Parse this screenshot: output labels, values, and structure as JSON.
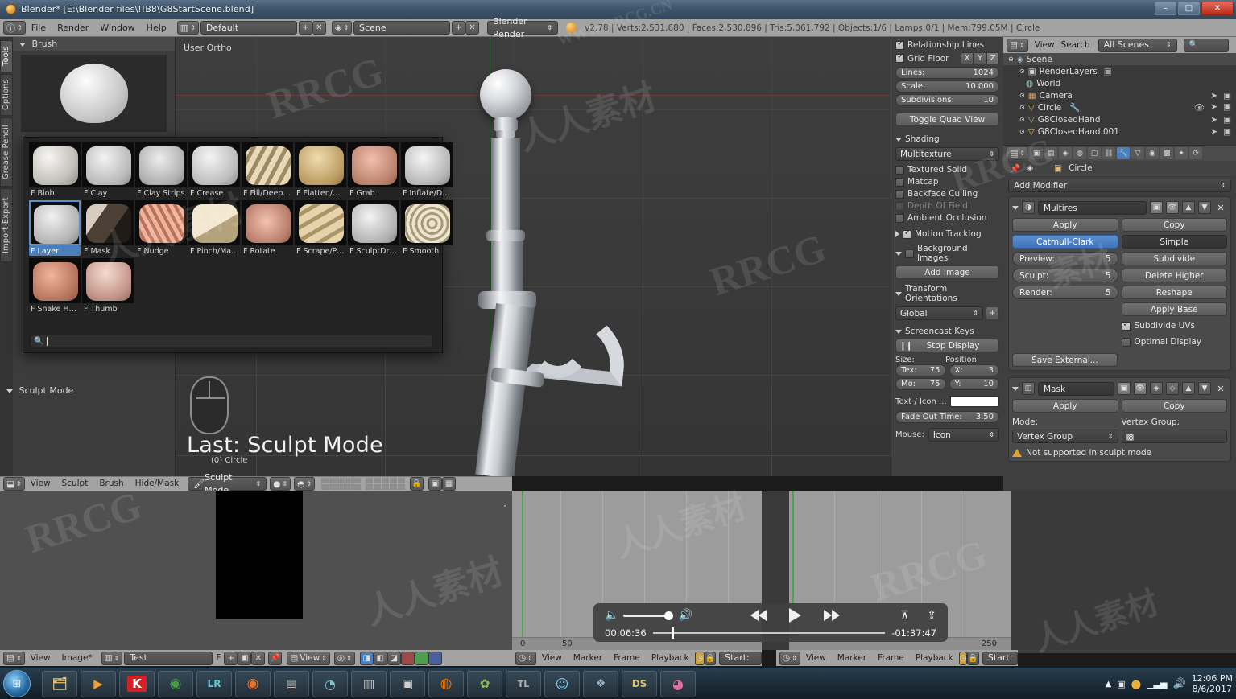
{
  "window": {
    "title": "Blender* [E:\\Blender files\\!!B8\\G8StartScene.blend]",
    "minimize": "–",
    "maximize": "□",
    "close": "✕"
  },
  "infobar": {
    "menus": [
      "File",
      "Render",
      "Window",
      "Help"
    ],
    "screen_layout": "Default",
    "scene_name": "Scene",
    "engine": "Blender Render",
    "stats": "v2.78 | Verts:2,531,680 | Faces:2,530,896 | Tris:5,061,792 | Objects:1/6 | Lamps:0/1 | Mem:799.05M | Circle",
    "add_icon": "+",
    "remove_icon": "✕"
  },
  "toolshelf": {
    "tabs": [
      "Tools",
      "Options",
      "Grease Pencil",
      "Import-Export"
    ],
    "active_tab": "Tools",
    "panel_title": "Brush",
    "sculpt_mode_panel": "Sculpt Mode"
  },
  "brush_popup": {
    "search_placeholder": "",
    "selected": "F Layer",
    "items": [
      {
        "label": "F Blob",
        "c1": "#f2f0ee",
        "c2": "#b9b4ae"
      },
      {
        "label": "F Clay",
        "c1": "#efefef",
        "c2": "#b3b3b3"
      },
      {
        "label": "F Clay Strips",
        "c1": "#e9e9e9",
        "c2": "#acacac"
      },
      {
        "label": "F Crease",
        "c1": "#f3f3f3",
        "c2": "#b6b6b6"
      },
      {
        "label": "F Fill/Deepen",
        "c1": "#e8d9b8",
        "c2": "#9d8a64"
      },
      {
        "label": "F Flatten/Co...",
        "c1": "#e4cd9f",
        "c2": "#b99a63"
      },
      {
        "label": "F Grab",
        "c1": "#e8b6a6",
        "c2": "#b97f6a"
      },
      {
        "label": "F Inflate/Defl",
        "c1": "#f1f1f1",
        "c2": "#b0b0b0"
      },
      {
        "label": "F Layer",
        "c1": "#ededed",
        "c2": "#adadad"
      },
      {
        "label": "F Mask",
        "c1": "#6b5a4e",
        "c2": "#2e2723"
      },
      {
        "label": "F Nudge",
        "c1": "#e9a892",
        "c2": "#b06e57"
      },
      {
        "label": "F Pinch/Mag...",
        "c1": "#efe2c6",
        "c2": "#b6a versus"
      },
      {
        "label": "F Rotate",
        "c1": "#efb9a4",
        "c2": "#b8776a"
      },
      {
        "label": "F Scrape/Pea",
        "c1": "#e3d0a8",
        "c2": "#aa9466"
      },
      {
        "label": "F SculptDraw",
        "c1": "#f0f0f0",
        "c2": "#aeaeae"
      },
      {
        "label": "F Smooth",
        "c1": "#e6ddc6",
        "c2": "#a59a7c"
      },
      {
        "label": "F Snake Hook",
        "c1": "#eaa892",
        "c2": "#b3705a"
      },
      {
        "label": "F Thumb",
        "c1": "#f0cfc4",
        "c2": "#bb8b7e"
      }
    ]
  },
  "viewport": {
    "view_label": "User Ortho",
    "last_operator": "Last: Sculpt Mode",
    "last_operator_sub": "(0) Circle"
  },
  "npanel": {
    "relationship_lines": "Relationship Lines",
    "grid_floor": "Grid Floor",
    "axes": [
      "X",
      "Y",
      "Z"
    ],
    "lines_label": "Lines:",
    "lines_value": "1024",
    "scale_label": "Scale:",
    "scale_value": "10.000",
    "subdiv_label": "Subdivisions:",
    "subdiv_value": "10",
    "toggle_quad_view": "Toggle Quad View",
    "shading_title": "Shading",
    "shading_mode": "Multitexture",
    "shading_options": [
      "Textured Solid",
      "Matcap",
      "Backface Culling",
      "Depth Of Field",
      "Ambient Occlusion"
    ],
    "motion_tracking": "Motion Tracking",
    "background_images": "Background Images",
    "add_image": "Add Image",
    "transform_orientations": "Transform Orientations",
    "orientation": "Global",
    "screencast_title": "Screencast Keys",
    "stop_display": "Stop Display",
    "size_label": "Size:",
    "position_label": "Position:",
    "tex_label": "Tex:",
    "tex_value": "75",
    "mo_label": "Mo:",
    "mo_value": "75",
    "x_label": "X:",
    "x_value": "3",
    "y_label": "Y:",
    "y_value": "10",
    "text_icon_label": "Text / Icon ...",
    "text_icon_value": "",
    "fade_label": "Fade Out Time:",
    "fade_value": "3.50",
    "mouse_label": "Mouse:",
    "mouse_value": "Icon"
  },
  "outliner": {
    "menus": [
      "View",
      "Search"
    ],
    "scope": "All Scenes",
    "search_value": "",
    "rows": [
      {
        "label": "Scene",
        "indent": 0,
        "selected": true
      },
      {
        "label": "RenderLayers",
        "indent": 1,
        "selected": false
      },
      {
        "label": "World",
        "indent": 1,
        "selected": false
      },
      {
        "label": "Camera",
        "indent": 1,
        "selected": false
      },
      {
        "label": "Circle",
        "indent": 1,
        "selected": false
      },
      {
        "label": "G8ClosedHand",
        "indent": 1,
        "selected": false
      },
      {
        "label": "G8ClosedHand.001",
        "indent": 1,
        "selected": false
      }
    ]
  },
  "properties": {
    "breadcrumb_object": "Circle",
    "add_modifier": "Add Modifier",
    "modifiers": [
      {
        "name": "Multires",
        "apply": "Apply",
        "copy": "Copy",
        "subdiv_type_a": "Catmull-Clark",
        "subdiv_type_b": "Simple",
        "levels": [
          {
            "label": "Preview:",
            "value": "5"
          },
          {
            "label": "Sculpt:",
            "value": "5"
          },
          {
            "label": "Render:",
            "value": "5"
          }
        ],
        "actions": [
          "Subdivide",
          "Delete Higher",
          "Reshape",
          "Apply Base"
        ],
        "checks": [
          {
            "label": "Subdivide UVs",
            "on": true
          },
          {
            "label": "Optimal Display",
            "on": false
          }
        ],
        "save_external": "Save External..."
      },
      {
        "name": "Mask",
        "apply": "Apply",
        "copy": "Copy",
        "mode_label": "Mode:",
        "mode_value": "Vertex Group",
        "vgroup_label": "Vertex Group:",
        "vgroup_value": "",
        "warning": "Not supported in sculpt mode"
      }
    ]
  },
  "viewport_footer": {
    "menus": [
      "View",
      "Sculpt",
      "Brush",
      "Hide/Mask"
    ],
    "mode": "Sculpt Mode"
  },
  "image_editor_footer": {
    "menus": [
      "View",
      "Image*"
    ],
    "image_name": "Test",
    "fake_user": "F",
    "add": "+",
    "view_mode": "View"
  },
  "timeline_footers": [
    {
      "menus": [
        "View",
        "Marker",
        "Frame",
        "Playback"
      ],
      "start_label": "Start:"
    },
    {
      "menus": [
        "View",
        "Marker",
        "Frame",
        "Playback"
      ],
      "start_label": "Start:"
    }
  ],
  "timeline": {
    "ticks_left": [
      "0",
      "50"
    ],
    "ticks_right": [
      "250"
    ]
  },
  "player": {
    "current_time": "00:06:36",
    "remaining_time": "-01:37:47",
    "volume_icon": "volume-icon",
    "rewind_icon": "rewind-icon",
    "play_icon": "play-icon",
    "forward_icon": "forward-icon",
    "airplay_icon": "airplay-icon",
    "share_icon": "share-icon"
  },
  "taskbar": {
    "items": [
      {
        "name": "file-explorer",
        "glyph": "🗂",
        "color": "#e8c473"
      },
      {
        "name": "media-player",
        "glyph": "▶",
        "color": "#f0a030"
      },
      {
        "name": "kmplayer",
        "glyph": "K",
        "color": "#d81f26"
      },
      {
        "name": "chrome",
        "glyph": "◉",
        "color": "#4a9e4a"
      },
      {
        "name": "lightroom",
        "glyph": "LR",
        "color": "#5fc9d8"
      },
      {
        "name": "firefox",
        "glyph": "◉",
        "color": "#e8742c"
      },
      {
        "name": "notepad",
        "glyph": "▤",
        "color": "#c8c8c8"
      },
      {
        "name": "analytics",
        "glyph": "◔",
        "color": "#7fc3c9"
      },
      {
        "name": "reader",
        "glyph": "▥",
        "color": "#dadada"
      },
      {
        "name": "printer",
        "glyph": "▣",
        "color": "#d0d0d0"
      },
      {
        "name": "blender",
        "glyph": "◍",
        "color": "#ea7600"
      },
      {
        "name": "unknown-green",
        "glyph": "✿",
        "color": "#8fbf4f"
      },
      {
        "name": "tl-app",
        "glyph": "TL",
        "color": "#b0b0b0"
      },
      {
        "name": "fallout",
        "glyph": "☺",
        "color": "#7fd4f0"
      },
      {
        "name": "daz-studio",
        "glyph": "🐾",
        "color": "#9fb0c8"
      },
      {
        "name": "ds-app",
        "glyph": "DS",
        "color": "#d9c06a"
      },
      {
        "name": "color-app",
        "glyph": "◕",
        "color": "#e06f9f"
      }
    ],
    "tray": {
      "time": "12:06 PM",
      "date": "8/6/2017",
      "network_icon": "network-icon",
      "volume_icon": "volume-icon",
      "security_icon": "security-icon",
      "update_icon": "update-icon"
    }
  },
  "watermarks": [
    "RRCG",
    "人人素材",
    "WWW.RRCG.CN"
  ]
}
